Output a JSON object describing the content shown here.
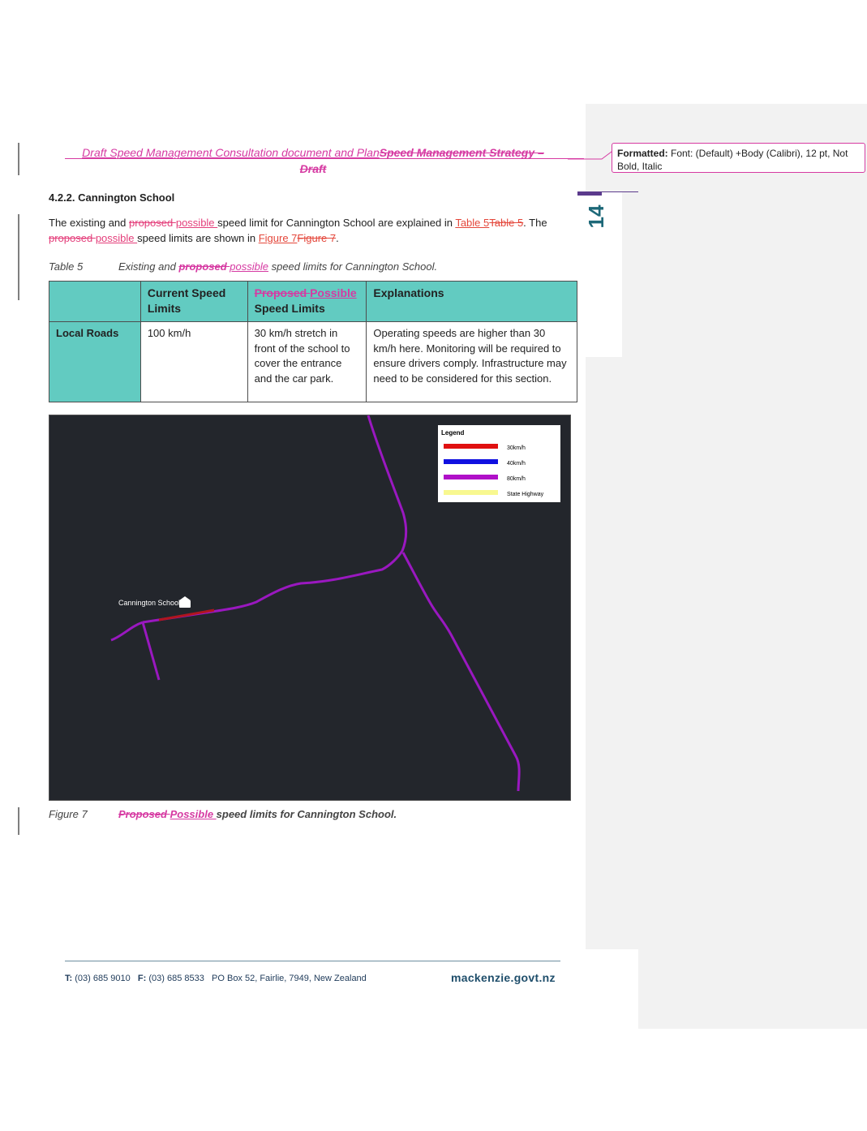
{
  "header": {
    "inserted": "Draft Speed Management Consultation document and Plan",
    "deleted_line1": "Speed Management Strategy –",
    "deleted_line2": "Draft"
  },
  "comment": {
    "label": "Formatted:",
    "text": " Font: (Default) +Body (Calibri), 12 pt, Not Bold, Italic"
  },
  "page_number": "14",
  "section": {
    "heading": "4.2.2. Cannington School",
    "para": {
      "t1": "The existing and ",
      "del1": "proposed ",
      "ins1": "possible ",
      "t2": "speed limit for Cannington School are explained in ",
      "xref1": "Table 5",
      "xref1_del": "Table 5",
      "t3": ". The ",
      "del2": "proposed ",
      "ins2": "possible ",
      "t4": "speed limits are shown in ",
      "xref2": "Figure 7",
      "xref2_del": "Figure 7",
      "t5": "."
    }
  },
  "table_caption": {
    "label": "Table 5",
    "t1": "Existing and ",
    "del": "proposed ",
    "ins": "possible",
    "t2": " speed limits for Cannington School."
  },
  "table": {
    "headers": {
      "current": "Current Speed Limits",
      "proposed_del": "Proposed ",
      "proposed_ins": "Possible",
      "proposed_rest": " Speed Limits",
      "explanations": "Explanations"
    },
    "rows": [
      {
        "label": "Local Roads",
        "current": "100 km/h",
        "proposed": "30 km/h stretch in front of the school to cover the entrance and the car park.",
        "explanation": "Operating speeds are higher than 30 km/h here. Monitoring will be required to ensure drivers comply. Infrastructure may need to be considered for this section."
      }
    ]
  },
  "map": {
    "school_label": "Cannington School",
    "legend": {
      "title": "Legend",
      "items": [
        {
          "label": "30km/h",
          "color": "#e01010"
        },
        {
          "label": "40km/h",
          "color": "#1010e0"
        },
        {
          "label": "80km/h",
          "color": "#b010c8"
        },
        {
          "label": "State Highway",
          "color": "#f8f890"
        }
      ]
    },
    "road_color": "#9a18c0",
    "zone_color": "#b0151f"
  },
  "figure_caption": {
    "label": "Figure 7",
    "del": "Proposed ",
    "ins": "Possible ",
    "rest": "speed limits for Cannington School."
  },
  "footer": {
    "t_label": "T:",
    "t_value": " (03) 685 9010",
    "f_label": "F:",
    "f_value": " (03) 685 8533",
    "address": "PO Box 52, Fairlie, 7949, New Zealand",
    "site": "mackenzie.govt.nz"
  }
}
